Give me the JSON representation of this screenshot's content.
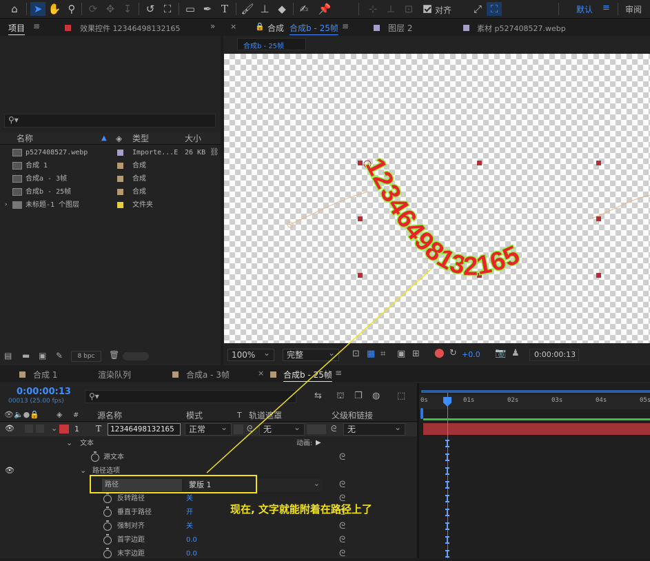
{
  "toolbar": {
    "tools": [
      "home-icon",
      "selection-icon",
      "hand-icon",
      "zoom-icon",
      "orbit-camera-icon",
      "pan-camera-icon",
      "dolly-camera-icon",
      "rotate-icon",
      "pan-behind-icon",
      "rectangle-icon",
      "pen-icon",
      "type-icon",
      "brush-icon",
      "stamp-icon",
      "eraser-icon",
      "roto-brush-icon",
      "puppet-pin-icon"
    ],
    "align_label": "对齐",
    "workspace_default": "默认",
    "workspace_review": "审阅"
  },
  "project_panel": {
    "tab_project": "项目",
    "tab_effects": "效果控件 12346498132165",
    "search_placeholder": "",
    "columns": {
      "name": "名称",
      "type": "类型",
      "size": "大小"
    },
    "items": [
      {
        "name": "p527408527.webp",
        "type": "Importe...E",
        "size": "26 KB",
        "swatch": "#a6a0c6"
      },
      {
        "name": "合成 1",
        "type": "合成",
        "size": "",
        "swatch": "#b39a74"
      },
      {
        "name": "合成a - 3帧",
        "type": "合成",
        "size": "",
        "swatch": "#b39a74"
      },
      {
        "name": "合成b - 25帧",
        "type": "合成",
        "size": "",
        "swatch": "#b39a74"
      },
      {
        "name": "未标题-1 个图层",
        "type": "文件夹",
        "size": "",
        "swatch": "#e3cf3c"
      }
    ],
    "bpc": "8 bpc"
  },
  "viewer": {
    "tab_comp_prefix": "合成",
    "tab_comp_name": "合成b - 25帧",
    "tab_layer": "图层 2",
    "tab_footage": "素材 p527408527.webp",
    "breadcrumb": "合成b - 25帧",
    "path_text": "12346498132165",
    "zoom": "100%",
    "resolution": "完整",
    "exposure": "+0.0",
    "timecode": "0:00:00:13"
  },
  "timeline": {
    "tabs": [
      "合成 1",
      "渲染队列",
      "合成a - 3帧",
      "合成b - 25帧"
    ],
    "timecode": "0:00:00:13",
    "frame_info": "00013 (25.00 fps)",
    "columns": {
      "num": "#",
      "source": "源名称",
      "mode": "模式",
      "t": "T",
      "matte": "轨道遮罩",
      "parent": "父级和链接"
    },
    "layer": {
      "index": "1",
      "type": "T",
      "name": "12346498132165",
      "mode": "正常",
      "matte": "无",
      "parent": "无"
    },
    "props": {
      "text": "文本",
      "animate": "动画:",
      "source_text": "源文本",
      "path_options": "路径选项",
      "path": "路径",
      "path_value": "蒙版 1",
      "reverse": "反转路径",
      "reverse_value": "关",
      "perpendicular": "垂直于路径",
      "perpendicular_value": "开",
      "force_align": "强制对齐",
      "force_align_value": "关",
      "first_margin": "首字边距",
      "first_margin_value": "0.0",
      "last_margin": "末字边距",
      "last_margin_value": "0.0"
    },
    "ruler": [
      "0s",
      "01s",
      "02s",
      "03s",
      "04s",
      "05s"
    ]
  },
  "annotation": "现在, 文字就能附着在路径上了",
  "colors": {
    "accent": "#3d8eff",
    "layer_red": "#c8363c",
    "text_fill": "#e8242a",
    "text_stroke": "#8ef03c",
    "annotation": "#f2e21a"
  }
}
